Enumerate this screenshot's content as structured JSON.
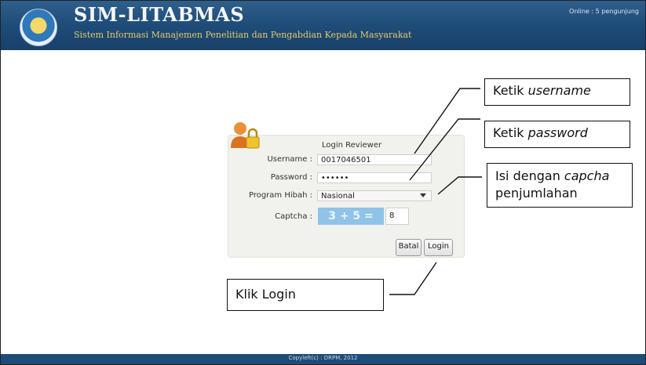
{
  "header": {
    "title": "SIM-LITABMAS",
    "subtitle": "Sistem Informasi Manajemen Penelitian dan Pengabdian Kepada Masyarakat",
    "online": "Online : 5 pengunjung"
  },
  "login": {
    "title": "Login Reviewer",
    "username_label": "Username :",
    "username_value": "0017046501",
    "password_label": "Password :",
    "password_value": "••••••",
    "program_label": "Program Hibah :",
    "program_value": "Nasional",
    "captcha_label": "Captcha :",
    "captcha_question": "3 + 5 =",
    "captcha_answer": "8",
    "cancel_label": "Batal",
    "login_label": "Login"
  },
  "callouts": {
    "username_prefix": "Ketik ",
    "username_em": "username",
    "password_prefix": "Ketik ",
    "password_em": "password",
    "captcha_prefix": "Isi dengan ",
    "captcha_em": "capcha",
    "captcha_suffix": "penjumlahan",
    "login": "Klik Login"
  },
  "footer": {
    "text": "Copyleft(c) : DRPM, 2012"
  }
}
